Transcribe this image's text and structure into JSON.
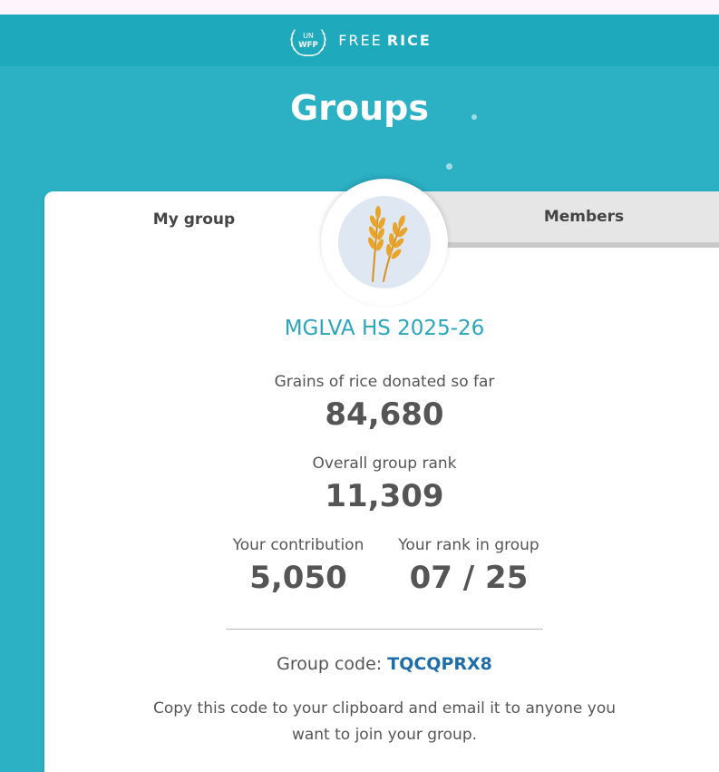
{
  "brand": {
    "logo_text_top": "UN",
    "logo_text_bottom": "WFP",
    "name_part1": "FREE",
    "name_part2": "RICE"
  },
  "page": {
    "title": "Groups"
  },
  "tabs": [
    {
      "label": "My group",
      "active": true
    },
    {
      "label": "Members",
      "active": false
    }
  ],
  "group": {
    "avatar_icon": "wheat-icon",
    "name": "MGLVA HS 2025-26",
    "grains_label": "Grains of rice donated so far",
    "grains_value": "84,680",
    "rank_label": "Overall group rank",
    "rank_value": "11,309",
    "contribution_label": "Your contribution",
    "contribution_value": "5,050",
    "ingroup_label": "Your rank in group",
    "ingroup_value": "07 / 25",
    "code_label": "Group code:",
    "code_value": "TQCQPRX8",
    "help_text": "Copy this code to your clipboard and email it to anyone you want to join your group."
  },
  "colors": {
    "background": "#2bb0c4",
    "header": "#1ea9bd",
    "accent": "#2aa6bb",
    "code": "#1f6ea8",
    "wheat": "#e8a52b"
  }
}
